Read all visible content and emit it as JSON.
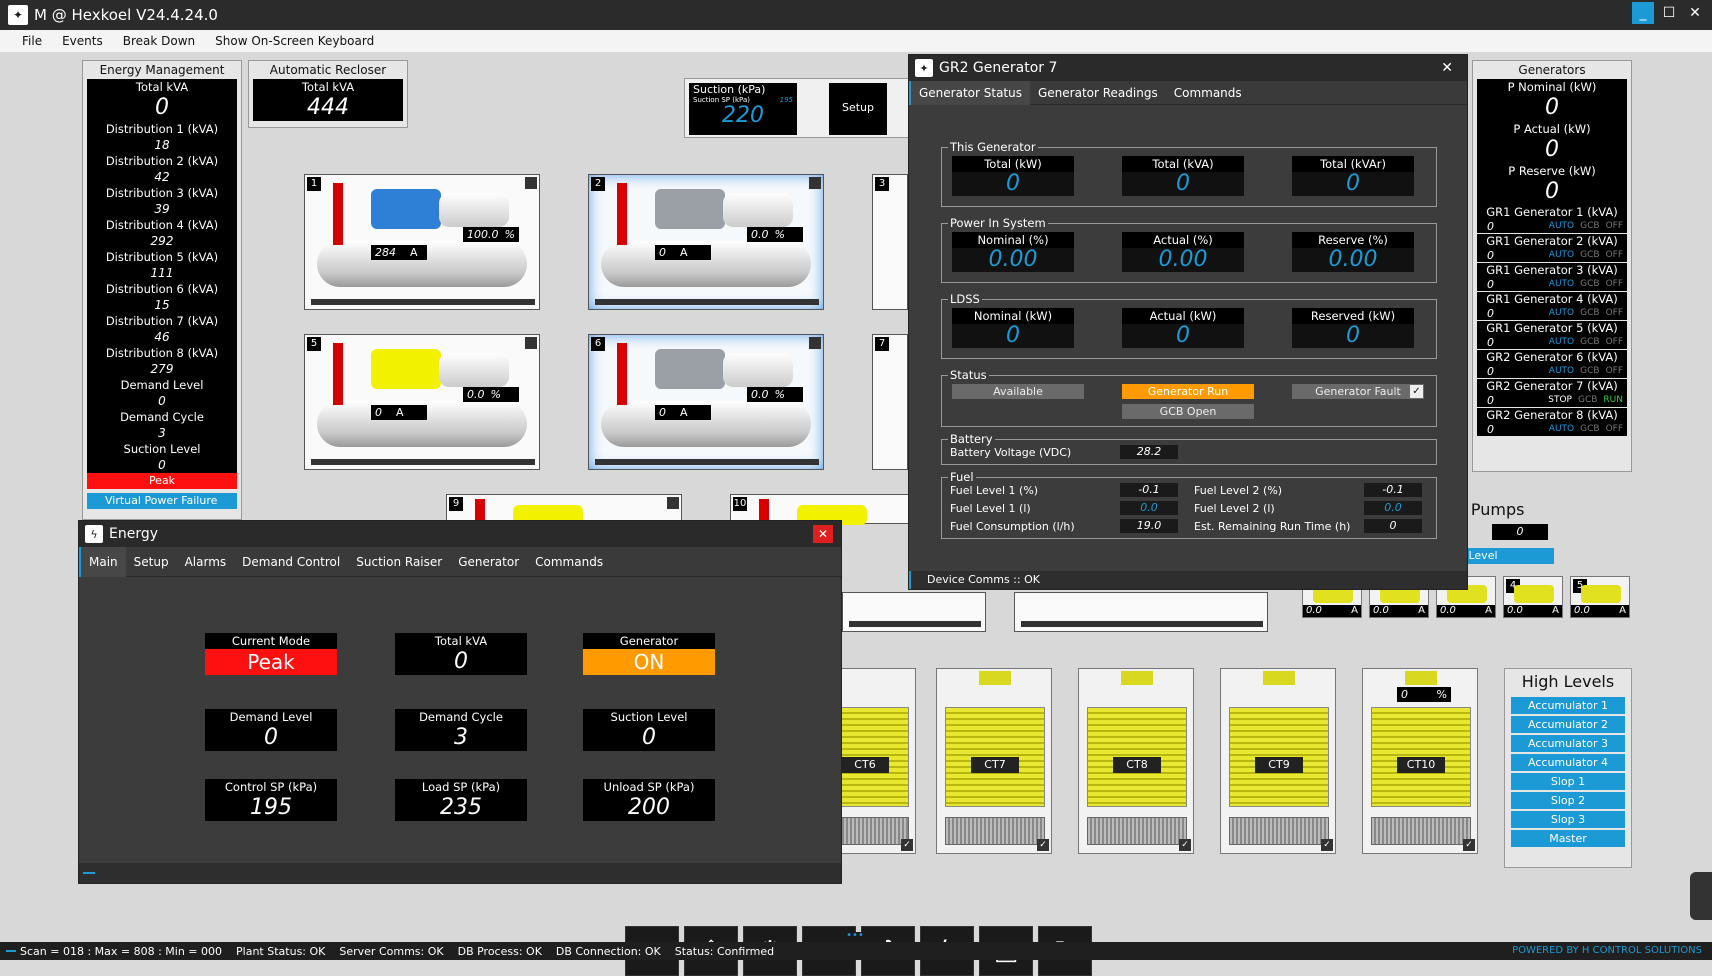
{
  "window": {
    "title": "M @ Hexkoel V24.4.24.0",
    "icon": "app-logo-icon"
  },
  "menu": [
    "File",
    "Events",
    "Break Down",
    "Show On-Screen Keyboard"
  ],
  "energy_mgmt": {
    "title": "Energy Management",
    "total_label": "Total kVA",
    "total_value": "0",
    "rows": [
      {
        "label": "Distribution 1 (kVA)",
        "value": "18"
      },
      {
        "label": "Distribution 2 (kVA)",
        "value": "42"
      },
      {
        "label": "Distribution 3 (kVA)",
        "value": "39"
      },
      {
        "label": "Distribution 4 (kVA)",
        "value": "292"
      },
      {
        "label": "Distribution 5 (kVA)",
        "value": "111"
      },
      {
        "label": "Distribution 6 (kVA)",
        "value": "15"
      },
      {
        "label": "Distribution 7 (kVA)",
        "value": "46"
      },
      {
        "label": "Distribution 8 (kVA)",
        "value": "279"
      },
      {
        "label": "Demand Level",
        "value": "0"
      },
      {
        "label": "Demand Cycle",
        "value": "3"
      },
      {
        "label": "Suction Level",
        "value": "0"
      }
    ],
    "mode": "Peak",
    "vpf": "Virtual Power Failure"
  },
  "recloser": {
    "title": "Automatic Recloser",
    "label": "Total kVA",
    "value": "444"
  },
  "suction": {
    "label": "Suction (kPa)",
    "sp_label": "Suction SP (kPa)",
    "sp_value": "195",
    "value": "220",
    "setup": "Setup"
  },
  "compressors": [
    {
      "num": "1",
      "amps": "284",
      "pct": "100.0",
      "unit_a": "A",
      "unit_pct": "%"
    },
    {
      "num": "2",
      "amps": "0",
      "pct": "0.0",
      "unit_a": "A",
      "unit_pct": "%"
    },
    {
      "num": "3"
    },
    {
      "num": "5",
      "amps": "0",
      "pct": "0.0",
      "unit_a": "A",
      "unit_pct": "%"
    },
    {
      "num": "6",
      "amps": "0",
      "pct": "0.0",
      "unit_a": "A",
      "unit_pct": "%"
    },
    {
      "num": "7"
    },
    {
      "num": "9"
    },
    {
      "num": "10"
    }
  ],
  "generators": {
    "title": "Generators",
    "p_nominal": {
      "label": "P Nominal (kW)",
      "value": "0"
    },
    "p_actual": {
      "label": "P Actual (kW)",
      "value": "0"
    },
    "p_reserve": {
      "label": "P Reserve (kW)",
      "value": "0"
    },
    "list": [
      {
        "label": "GR1 Generator 1 (kVA)",
        "value": "0",
        "mode": "AUTO",
        "gcb": "GCB",
        "state": "OFF"
      },
      {
        "label": "GR1 Generator 2 (kVA)",
        "value": "0",
        "mode": "AUTO",
        "gcb": "GCB",
        "state": "OFF"
      },
      {
        "label": "GR1 Generator 3 (kVA)",
        "value": "0",
        "mode": "AUTO",
        "gcb": "GCB",
        "state": "OFF"
      },
      {
        "label": "GR1 Generator 4 (kVA)",
        "value": "0",
        "mode": "AUTO",
        "gcb": "GCB",
        "state": "OFF"
      },
      {
        "label": "GR1 Generator 5 (kVA)",
        "value": "0",
        "mode": "AUTO",
        "gcb": "GCB",
        "state": "OFF"
      },
      {
        "label": "GR2 Generator 6 (kVA)",
        "value": "0",
        "mode": "AUTO",
        "gcb": "GCB",
        "state": "OFF"
      },
      {
        "label": "GR2 Generator 7 (kVA)",
        "value": "0",
        "mode": "STOP",
        "gcb": "GCB",
        "state": "RUN"
      },
      {
        "label": "GR2 Generator 8 (kVA)",
        "value": "0",
        "mode": "AUTO",
        "gcb": "GCB",
        "state": "OFF"
      }
    ]
  },
  "pumps": {
    "title": "a Pumps",
    "field_label": "a)",
    "field_value": "0",
    "level": "g Level",
    "items": [
      {
        "num": "",
        "amps": "0.0",
        "unit": "A"
      },
      {
        "num": "",
        "amps": "0.0",
        "unit": "A"
      },
      {
        "num": "",
        "amps": "0.0",
        "unit": "A"
      },
      {
        "num": "4",
        "amps": "0.0",
        "unit": "A"
      },
      {
        "num": "5",
        "amps": "0.0",
        "unit": "A"
      }
    ]
  },
  "cts": [
    {
      "label": "CT6"
    },
    {
      "label": "CT7"
    },
    {
      "label": "CT8"
    },
    {
      "label": "CT9"
    },
    {
      "label": "CT10",
      "pct": "0",
      "unit": "%"
    }
  ],
  "high_levels": {
    "title": "High Levels",
    "items": [
      "Accumulator 1",
      "Accumulator 2",
      "Accumulator 3",
      "Accumulator 4",
      "Slop 1",
      "Slop 2",
      "Slop 3",
      "Master"
    ]
  },
  "gen_dialog": {
    "title": "GR2 Generator 7",
    "tabs": [
      "Generator Status",
      "Generator Readings",
      "Commands"
    ],
    "this_gen": {
      "title": "This Generator",
      "items": [
        {
          "label": "Total (kW)",
          "value": "0"
        },
        {
          "label": "Total (kVA)",
          "value": "0"
        },
        {
          "label": "Total (kVAr)",
          "value": "0"
        }
      ]
    },
    "power": {
      "title": "Power In System",
      "items": [
        {
          "label": "Nominal (%)",
          "value": "0.00"
        },
        {
          "label": "Actual (%)",
          "value": "0.00"
        },
        {
          "label": "Reserve (%)",
          "value": "0.00"
        }
      ]
    },
    "ldss": {
      "title": "LDSS",
      "items": [
        {
          "label": "Nominal (kW)",
          "value": "0"
        },
        {
          "label": "Actual (kW)",
          "value": "0"
        },
        {
          "label": "Reserved (kW)",
          "value": "0"
        }
      ]
    },
    "status": {
      "title": "Status",
      "available": "Available",
      "run": "Generator Run",
      "fault": "Generator Fault",
      "gcb": "GCB Open"
    },
    "battery": {
      "title": "Battery",
      "label": "Battery Voltage (VDC)",
      "value": "28.2"
    },
    "fuel": {
      "title": "Fuel",
      "l1_label": "Fuel Level 1 (%)",
      "l1_value": "-0.1",
      "l2_label": "Fuel Level 2 (%)",
      "l2_value": "-0.1",
      "l1l_label": "Fuel Level 1 (l)",
      "l1l_value": "0.0",
      "l2l_label": "Fuel Level 2 (l)",
      "l2l_value": "0.0",
      "cons_label": "Fuel Consumption (l/h)",
      "cons_value": "19.0",
      "run_label": "Est. Remaining Run Time (h)",
      "run_value": "0"
    },
    "footer": "Device Comms :: OK"
  },
  "energy_dialog": {
    "title": "Energy",
    "tabs": [
      "Main",
      "Setup",
      "Alarms",
      "Demand Control",
      "Suction Raiser",
      "Generator",
      "Commands"
    ],
    "current_mode": {
      "label": "Current Mode",
      "value": "Peak"
    },
    "total_kva": {
      "label": "Total kVA",
      "value": "0"
    },
    "generator": {
      "label": "Generator",
      "value": "ON"
    },
    "demand_level": {
      "label": "Demand Level",
      "value": "0"
    },
    "demand_cycle": {
      "label": "Demand Cycle",
      "value": "3"
    },
    "suction_level": {
      "label": "Suction Level",
      "value": "0"
    },
    "control_sp": {
      "label": "Control SP (kPa)",
      "value": "195"
    },
    "load_sp": {
      "label": "Load SP (kPa)",
      "value": "235"
    },
    "unload_sp": {
      "label": "Unload SP (kPa)",
      "value": "200"
    }
  },
  "status": {
    "scan": "Scan = 018 : Max = 808 : Min = 000",
    "plant": "Plant Status: OK",
    "server": "Server Comms: OK",
    "db": "DB Process: OK",
    "dbconn": "DB Connection: OK",
    "st": "Status: Confirmed",
    "powered": "POWERED BY H CONTROL SOLUTIONS"
  }
}
